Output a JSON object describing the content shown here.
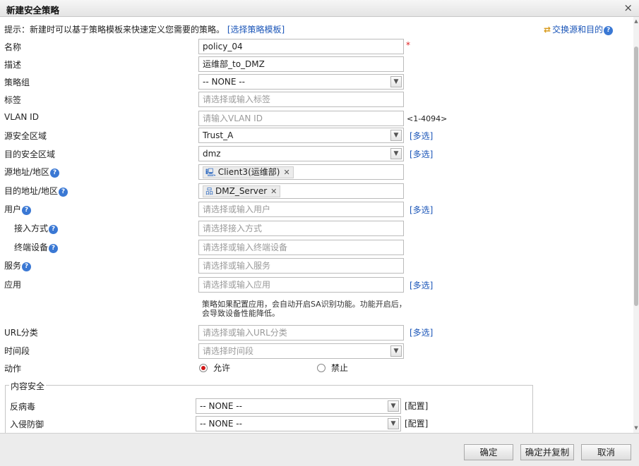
{
  "dialog": {
    "title": "新建安全策略",
    "close": "×"
  },
  "hint": {
    "text": "提示：新建时可以基于策略模板来快速定义您需要的策略。",
    "link": "[选择策略模板]"
  },
  "swap": {
    "icon": "swap-arrows-icon",
    "label": "交换源和目的"
  },
  "form": {
    "name": {
      "label": "名称",
      "value": "policy_04",
      "required": "*"
    },
    "description": {
      "label": "描述",
      "value": "运维部_to_DMZ"
    },
    "policy_group": {
      "label": "策略组",
      "value": "-- NONE --"
    },
    "tag": {
      "label": "标签",
      "placeholder": "请选择或输入标签"
    },
    "vlan": {
      "label": "VLAN ID",
      "placeholder": "请输入VLAN ID",
      "range": "<1-4094>"
    },
    "src_zone": {
      "label": "源安全区域",
      "value": "Trust_A",
      "multi": "[多选]"
    },
    "dst_zone": {
      "label": "目的安全区域",
      "value": "dmz",
      "multi": "[多选]"
    },
    "src_addr": {
      "label": "源地址/地区",
      "chip": "Client3(运维部)",
      "chip_icon": "computer-icon"
    },
    "dst_addr": {
      "label": "目的地址/地区",
      "chip": "DMZ_Server",
      "chip_icon": "server-network-icon"
    },
    "user": {
      "label": "用户",
      "placeholder": "请选择或输入用户",
      "multi": "[多选]"
    },
    "access_mode": {
      "label": "接入方式",
      "placeholder": "请选择接入方式"
    },
    "terminal": {
      "label": "终端设备",
      "placeholder": "请选择或输入终端设备"
    },
    "service": {
      "label": "服务",
      "placeholder": "请选择或输入服务"
    },
    "application": {
      "label": "应用",
      "placeholder": "请选择或输入应用",
      "multi": "[多选]"
    },
    "app_note": "策略如果配置应用，会自动开启SA识别功能。功能开启后，会导致设备性能降低。",
    "url": {
      "label": "URL分类",
      "placeholder": "请选择或输入URL分类",
      "multi": "[多选]"
    },
    "time": {
      "label": "时间段",
      "placeholder": "请选择时间段"
    },
    "action": {
      "label": "动作",
      "allow": "允许",
      "deny": "禁止",
      "selected": "允许"
    }
  },
  "content_security": {
    "legend": "内容安全",
    "antivirus": {
      "label": "反病毒",
      "value": "-- NONE --",
      "config": "[配置]"
    },
    "ips": {
      "label": "入侵防御",
      "value": "-- NONE --",
      "config": "[配置]"
    }
  },
  "footer": {
    "ok": "确定",
    "ok_copy": "确定并复制",
    "cancel": "取消"
  },
  "colors": {
    "link": "#1a55b8",
    "required": "#e02020",
    "help_badge": "#3a78d4",
    "radio_selected": "#d01818"
  }
}
